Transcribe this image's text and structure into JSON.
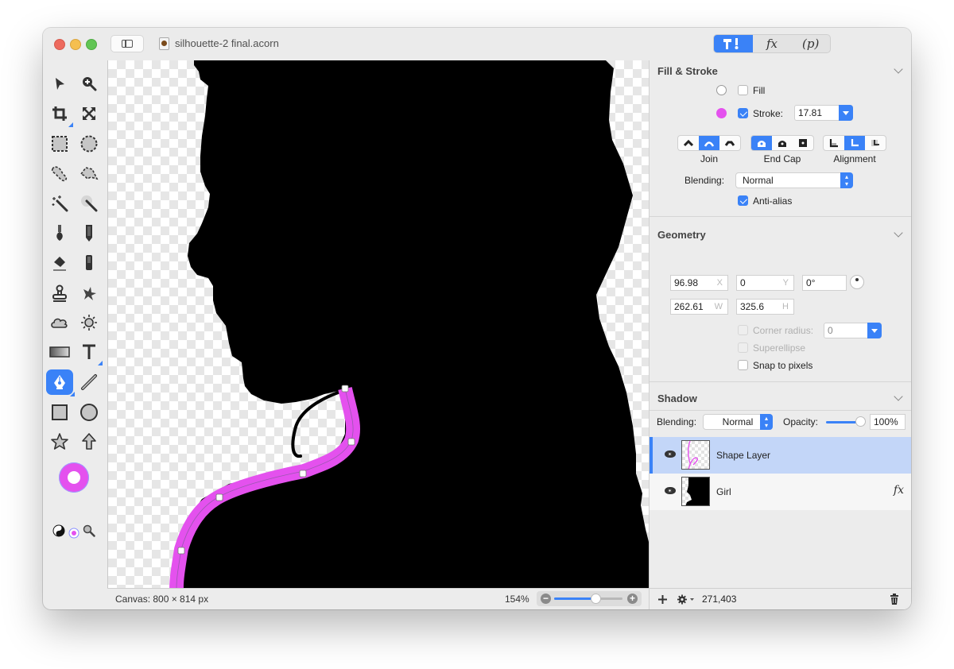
{
  "window": {
    "title": "silhouette-2 final.acorn",
    "inspector_tabs": [
      {
        "name": "tools",
        "label": "T!",
        "active": true
      },
      {
        "name": "fx",
        "label": "fx",
        "active": false
      },
      {
        "name": "properties",
        "label": "(p)",
        "active": false
      }
    ]
  },
  "toolbox": {
    "tools": [
      {
        "name": "select-arrow",
        "active": false
      },
      {
        "name": "zoom",
        "active": false
      },
      {
        "name": "crop",
        "active": false
      },
      {
        "name": "transform",
        "active": false
      },
      {
        "name": "rect-select",
        "active": false
      },
      {
        "name": "ellipse-select",
        "active": false
      },
      {
        "name": "lasso",
        "active": false
      },
      {
        "name": "polygon-lasso",
        "active": false
      },
      {
        "name": "magic-wand",
        "active": false
      },
      {
        "name": "instant-alpha",
        "active": false
      },
      {
        "name": "brush",
        "active": false
      },
      {
        "name": "pencil",
        "active": false
      },
      {
        "name": "eraser",
        "active": false
      },
      {
        "name": "smudge",
        "active": false
      },
      {
        "name": "clone-stamp",
        "active": false
      },
      {
        "name": "splatter",
        "active": false
      },
      {
        "name": "cloud",
        "active": false
      },
      {
        "name": "brightness",
        "active": false
      },
      {
        "name": "gradient",
        "active": false
      },
      {
        "name": "text",
        "active": false
      },
      {
        "name": "bezier-pen",
        "active": true
      },
      {
        "name": "line",
        "active": false
      },
      {
        "name": "rectangle",
        "active": false
      },
      {
        "name": "oval",
        "active": false
      },
      {
        "name": "star",
        "active": false
      },
      {
        "name": "arrow-shape",
        "active": false
      }
    ],
    "stroke_color": "#e451ee"
  },
  "status": {
    "canvas_size": "Canvas: 800 × 814 px",
    "zoom": "154%",
    "zoom_slider_fraction": 0.6
  },
  "inspector": {
    "fill_stroke": {
      "title": "Fill & Stroke",
      "fill_label": "Fill",
      "fill_checked": false,
      "fill_color": "#ffffff",
      "stroke_label": "Stroke:",
      "stroke_checked": true,
      "stroke_color": "#e451ee",
      "stroke_width": "17.81",
      "join_label": "Join",
      "join_selected": "round",
      "endcap_label": "End Cap",
      "endcap_selected": "butt",
      "alignment_label": "Alignment",
      "alignment_selected": "center",
      "blending_label": "Blending:",
      "blending_value": "Normal",
      "antialias_label": "Anti-alias",
      "antialias_checked": true
    },
    "geometry": {
      "title": "Geometry",
      "x": "96.98",
      "x_unit": "X",
      "y": "0",
      "y_unit": "Y",
      "rotation": "0°",
      "w": "262.61",
      "w_unit": "W",
      "h": "325.6",
      "h_unit": "H",
      "corner_radius_label": "Corner radius:",
      "corner_radius_value": "0",
      "superellipse_label": "Superellipse",
      "snap_label": "Snap to pixels"
    },
    "shadow": {
      "title": "Shadow"
    },
    "layers_bar": {
      "blending_label": "Blending:",
      "blending_value": "Normal",
      "opacity_label": "Opacity:",
      "opacity_value": "100%",
      "opacity_fraction": 1.0
    },
    "layers": [
      {
        "name": "Shape Layer",
        "selected": true,
        "visible": true,
        "has_fx": false
      },
      {
        "name": "Girl",
        "selected": false,
        "visible": true,
        "has_fx": true,
        "fx_label": "fx"
      }
    ],
    "footer": {
      "count": "271,403"
    }
  }
}
